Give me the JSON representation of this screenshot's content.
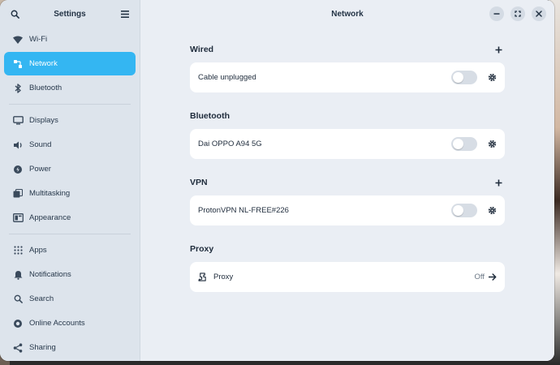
{
  "sidebar": {
    "title": "Settings",
    "items": [
      {
        "label": "Wi-Fi",
        "icon": "wifi-icon"
      },
      {
        "label": "Network",
        "icon": "network-icon",
        "active": true
      },
      {
        "label": "Bluetooth",
        "icon": "bluetooth-icon"
      },
      {
        "label": "Displays",
        "icon": "display-icon"
      },
      {
        "label": "Sound",
        "icon": "sound-icon"
      },
      {
        "label": "Power",
        "icon": "power-icon"
      },
      {
        "label": "Multitasking",
        "icon": "multitasking-icon"
      },
      {
        "label": "Appearance",
        "icon": "appearance-icon"
      },
      {
        "label": "Apps",
        "icon": "apps-icon"
      },
      {
        "label": "Notifications",
        "icon": "bell-icon"
      },
      {
        "label": "Search",
        "icon": "search-icon"
      },
      {
        "label": "Online Accounts",
        "icon": "online-accounts-icon"
      },
      {
        "label": "Sharing",
        "icon": "share-icon"
      }
    ]
  },
  "main": {
    "title": "Network",
    "sections": {
      "wired": {
        "title": "Wired",
        "item": "Cable unplugged",
        "enabled": false
      },
      "bluetooth": {
        "title": "Bluetooth",
        "item": "Dai OPPO A94 5G",
        "enabled": false
      },
      "vpn": {
        "title": "VPN",
        "item": "ProtonVPN NL-FREE#226",
        "enabled": false
      },
      "proxy": {
        "title": "Proxy",
        "item": "Proxy",
        "status": "Off"
      }
    }
  },
  "colors": {
    "accent": "#34b6f2",
    "sidebar_bg": "#dde4ec",
    "content_bg": "#eaeef4"
  }
}
